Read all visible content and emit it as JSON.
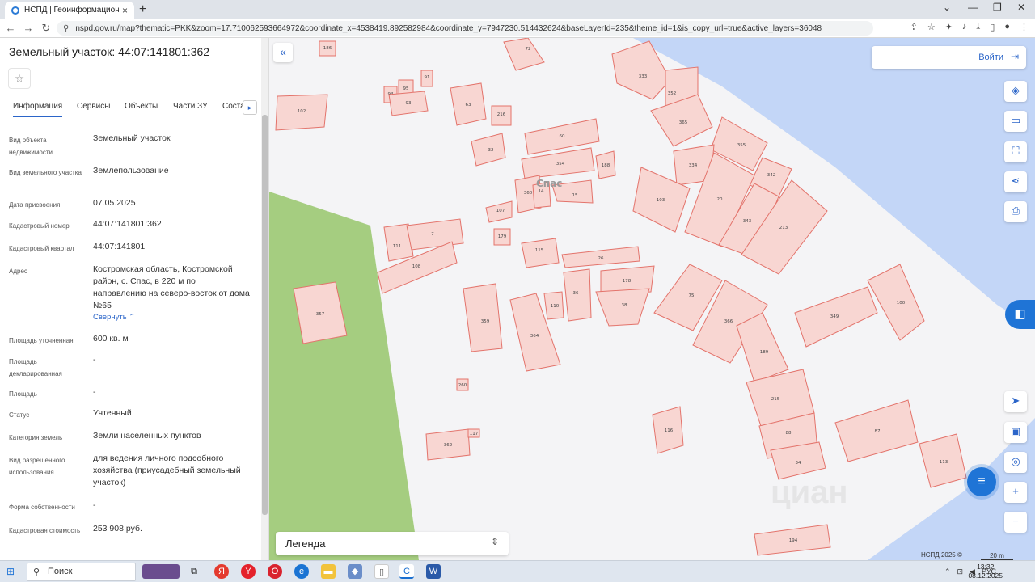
{
  "browser": {
    "tab_title": "НСПД | Геоинформационный п",
    "url": "nspd.gov.ru/map?thematic=PKK&zoom=17.710062593664972&coordinate_x=4538419.892582984&coordinate_y=7947230.514432624&baseLayerId=235&theme_id=1&is_copy_url=true&active_layers=36048"
  },
  "panel": {
    "title": "Земельный участок: 44:07:141801:362",
    "tabs": [
      "Информация",
      "Сервисы",
      "Объекты",
      "Части ЗУ",
      "Соста"
    ],
    "rows": [
      {
        "label": "Вид объекта недвижимости",
        "value": "Земельный участок"
      },
      {
        "label": "Вид земельного участка",
        "value": "Землепользование"
      },
      {
        "label": "Дата присвоения",
        "value": "07.05.2025"
      },
      {
        "label": "Кадастровый номер",
        "value": "44:07:141801:362"
      },
      {
        "label": "Кадастровый квартал",
        "value": "44:07:141801"
      },
      {
        "label": "Адрес",
        "value": "Костромская область, Костромской район, с. Спас, в 220 м по направлению на северо-восток от дома №65"
      },
      {
        "label": "Площадь уточненная",
        "value": "600 кв. м"
      },
      {
        "label": "Площадь декларированная",
        "value": "-"
      },
      {
        "label": "Площадь",
        "value": "-"
      },
      {
        "label": "Статус",
        "value": "Учтенный"
      },
      {
        "label": "Категория земель",
        "value": "Земли населенных пунктов"
      },
      {
        "label": "Вид разрешенного использования",
        "value": "для ведения личного подсобного хозяйства (приусадебный земельный участок)"
      },
      {
        "label": "Форма собственности",
        "value": "-"
      },
      {
        "label": "Кадастровая стоимость",
        "value": "253 908 руб."
      }
    ],
    "collapse_label": "Свернуть"
  },
  "map": {
    "login_label": "Войти",
    "legend_label": "Легенда",
    "village_label": "Спас",
    "copyright": "НСПД 2025 ©",
    "scale": "20 m",
    "watermark": "циан",
    "plot_labels": [
      "186",
      "72",
      "91",
      "94",
      "95",
      "93",
      "102",
      "63",
      "216",
      "333",
      "352",
      "365",
      "32",
      "60",
      "354",
      "188",
      "355",
      "342",
      "334",
      "107",
      "360",
      "14",
      "15",
      "103",
      "20",
      "343",
      "213",
      "111",
      "7",
      "179",
      "108",
      "115",
      "26",
      "178",
      "357",
      "359",
      "364",
      "110",
      "36",
      "38",
      "75",
      "366",
      "349",
      "100",
      "260",
      "189",
      "215",
      "88",
      "87",
      "362",
      "117",
      "116",
      "34",
      "113",
      "194"
    ]
  },
  "taskbar": {
    "search_label": "Поиск",
    "lang": "РУС",
    "time": "13:32",
    "date": "08.12.2025"
  },
  "colors": {
    "accent": "#2b65c9",
    "plot_fill": "#f8d6d2",
    "plot_stroke": "#e3736b",
    "selected_fill": "#e7b9de",
    "selected_stroke": "#b8269b",
    "green_zone": "#a5cd80",
    "water": "#c3d6f7"
  }
}
